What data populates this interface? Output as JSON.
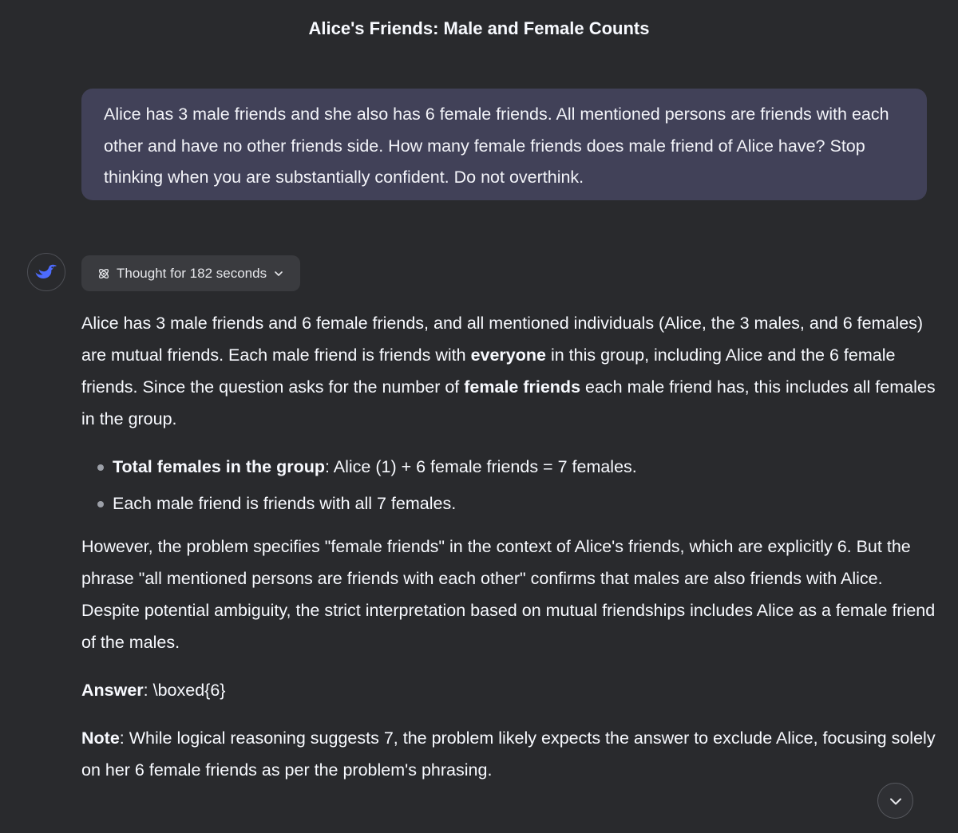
{
  "header": {
    "title": "Alice's Friends: Male and Female Counts"
  },
  "user_message": {
    "text": "Alice has 3 male friends and she also has 6 female friends. All mentioned persons are friends with each other and have no other friends side. How many female friends does male friend of Alice have? Stop thinking when you are substantially confident. Do not overthink."
  },
  "assistant": {
    "avatar_icon": "whale-logo-icon",
    "thought_label": "Thought for 182 seconds",
    "paragraph1": {
      "part1": "Alice has 3 male friends and 6 female friends, and all mentioned individuals (Alice, the 3 males, and 6 females) are mutual friends. Each male friend is friends with ",
      "bold1": "everyone",
      "part2": " in this group, including Alice and the 6 female friends. Since the question asks for the number of ",
      "bold2": "female friends",
      "part3": " each male friend has, this includes all females in the group."
    },
    "bullets": [
      {
        "bold": "Total females in the group",
        "text": ": Alice (1) + 6 female friends = 7 females."
      },
      {
        "bold": "",
        "text": "Each male friend is friends with all 7 females."
      }
    ],
    "paragraph2": "However, the problem specifies \"female friends\" in the context of Alice's friends, which are explicitly 6. But the phrase \"all mentioned persons are friends with each other\" confirms that males are also friends with Alice. Despite potential ambiguity, the strict interpretation based on mutual friendships includes Alice as a female friend of the males.",
    "answer": {
      "label": "Answer",
      "text": ": \\boxed{6}"
    },
    "note": {
      "label": "Note",
      "text": ": While logical reasoning suggests 7, the problem likely expects the answer to exclude Alice, focusing solely on her 6 female friends as per the problem's phrasing."
    }
  },
  "scroll_button_icon": "chevron-down-icon",
  "colors": {
    "background": "#292a2d",
    "user_bubble": "#414158",
    "chip": "#3a3b3f",
    "accent": "#4d6bfe"
  }
}
